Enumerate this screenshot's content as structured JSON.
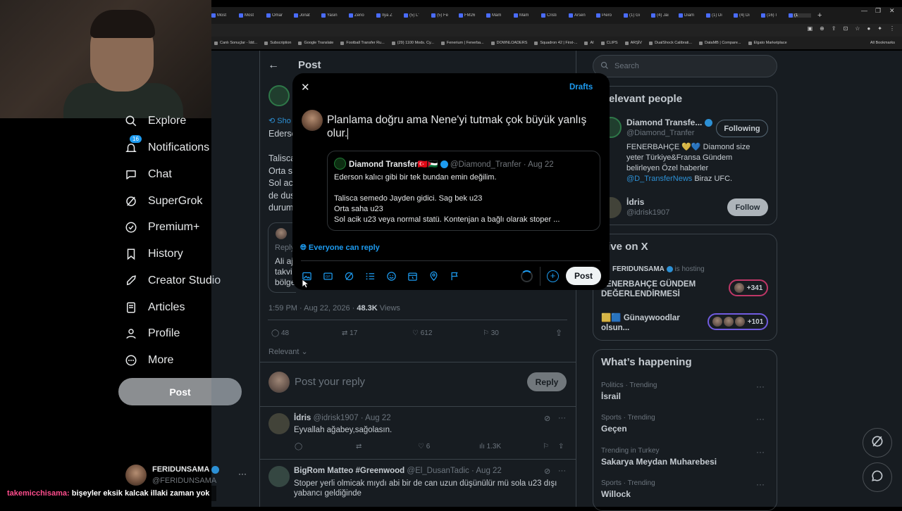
{
  "browser": {
    "tabs": [
      "Most",
      "Most",
      "Omar",
      "Jonat",
      "Yasin",
      "Zeno",
      "Ilya Z",
      "(5) L'",
      "(5) Fe",
      "FM26",
      "Mam",
      "Mam",
      "Cristi",
      "Arsen",
      "Piero",
      "(1) Gi",
      "(4) Jai",
      "Diam",
      "(1) Di",
      "(4) Di",
      "(16) I",
      "(1"
    ],
    "active_tab_index": 21,
    "new_tab": "+",
    "bookmarks": [
      "Canlı Sonuçlar - İdd...",
      "Subscription",
      "Google Translate",
      "Football Transfer Ru...",
      "(29) 1100 Mods. Cy...",
      "Fenerium | Fenerba...",
      "DOWNLOADERS",
      "Squadron 42 | First-...",
      "AI",
      "CLIPS",
      "ARŞİV",
      "DualShock Calibrati...",
      "DataMB | Compare...",
      "Elgato Marketplace"
    ],
    "all_bookmarks": "All Bookmarks"
  },
  "nav": {
    "items": [
      {
        "label": "Explore",
        "icon": "search-icon"
      },
      {
        "label": "Notifications",
        "icon": "bell-icon",
        "badge": "16"
      },
      {
        "label": "Chat",
        "icon": "chat-icon"
      },
      {
        "label": "SuperGrok",
        "icon": "grok-icon"
      },
      {
        "label": "Premium+",
        "icon": "premium-icon"
      },
      {
        "label": "History",
        "icon": "bookmark-icon"
      },
      {
        "label": "Creator Studio",
        "icon": "rocket-icon"
      },
      {
        "label": "Articles",
        "icon": "article-icon"
      },
      {
        "label": "Profile",
        "icon": "person-icon"
      },
      {
        "label": "More",
        "icon": "more-icon"
      }
    ],
    "post_button": "Post",
    "account": {
      "name": "FERIDUNSAMA",
      "handle": "@FERIDUNSAMA",
      "more": "···"
    }
  },
  "main": {
    "header_title": "Post",
    "post_fragments": [
      "Ederson",
      "Talisca",
      "Orta s",
      "Sol ac",
      "de dus",
      "durum"
    ],
    "quoted_fragment": {
      "lines": [
        "Ali aj",
        "takvi",
        "bölge"
      ],
      "reply_prefix": "Reply"
    },
    "timestamp": "1:59 PM · Aug 22, 2026 · ",
    "views_count": "48.3K",
    "views_label": " Views",
    "actions": {
      "replies": "48",
      "reposts": "17",
      "likes": "612",
      "bookmarks": "30"
    },
    "sort_label": "Relevant",
    "composer_placeholder": "Post your reply",
    "composer_reply": "Reply",
    "replies": [
      {
        "name": "İdris",
        "handle": "@idrisk1907",
        "date": "· Aug 22",
        "text": "Eyvallah ağabey,sağolasın.",
        "likes": "6",
        "views": "1.3K"
      },
      {
        "name": "BigRom Matteo #Greenwood",
        "handle": "@El_DusanTadic",
        "date": "· Aug 22",
        "text": "Stoper yerli olmicak mıydı abi bir de can uzun düşünülür mü sola u23 dışı yabancı geldiğinde"
      }
    ]
  },
  "modal": {
    "drafts": "Drafts",
    "draft_text": "Planlama doğru ama Nene'yi tutmak çok büyük yanlış olur.",
    "quote": {
      "name": "Diamond Transfer",
      "flags": "🇹🇷🇵🇸",
      "handle": "@Diamond_Tranfer",
      "date": "· Aug 22",
      "lines": [
        "Ederson kalıcı gibi bir tek bundan emin değilim.",
        "",
        "Talisca semedo Jayden gidici. Sag bek u23",
        "Orta saha u23",
        "Sol acik u23 veya normal statü. Kontenjan a bağlı olarak stoper ..."
      ]
    },
    "reply_setting": "Everyone can reply",
    "post_button": "Post"
  },
  "sidebar": {
    "search_placeholder": "Search",
    "relevant_title": "Relevant people",
    "people": [
      {
        "name": "Diamond Transfe...",
        "handle": "@Diamond_Tranfer",
        "button": "Following",
        "bio": "FENERBAHÇE 💛💙 Diamond size yeter Türkiye&Fransa Gündem belirleyen Özel haberler",
        "bio_link": "@D_TransferNews",
        "bio_tail": " Biraz UFC."
      },
      {
        "name": "İdris",
        "handle": "@idrisk1907",
        "button": "Follow"
      }
    ],
    "live_title": "Live on X",
    "live": [
      {
        "host": "FERIDUNSAMA",
        "status": "is hosting",
        "title": "FENERBAHÇE GÜNDEM DEĞERLENDİRMESİ",
        "count": "+341"
      },
      {
        "title": "🟨🟦 Günaywoodlar olsun...",
        "count": "+101"
      }
    ],
    "happening_title": "What’s happening",
    "trends": [
      {
        "category": "Politics · Trending",
        "name": "İsrail"
      },
      {
        "category": "Sports · Trending",
        "name": "Geçen"
      },
      {
        "category": "Trending in Turkey",
        "name": "Sakarya Meydan Muharebesi"
      },
      {
        "category": "Sports · Trending",
        "name": "Willock"
      }
    ]
  },
  "stream_chat": {
    "user": "takemicchisama:",
    "message": " bişeyler eksik kalcak illaki zaman yok"
  },
  "colors": {
    "accent": "#1d9bf0",
    "background": "#000000",
    "border": "#2f3336",
    "muted": "#71767b",
    "chat_user": "#ff4d8d",
    "live_ring": "#e0245e",
    "live_ring_2": "#7856ff"
  }
}
